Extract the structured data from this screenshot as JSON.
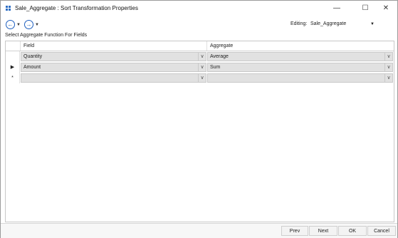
{
  "window": {
    "title": "Sale_Aggregate : Sort Transformation Properties",
    "minimize": "—",
    "maximize": "☐",
    "close": "✕"
  },
  "toolbar": {
    "back_icon": "←",
    "forward_icon": "→",
    "dropdown_glyph": "▼",
    "editing_label": "Editing:",
    "editing_value": "Sale_Aggregate",
    "editing_arrow": "▼"
  },
  "section": {
    "label": "Select Aggregate Function For Fields"
  },
  "grid": {
    "columns": [
      "Field",
      "Aggregate"
    ],
    "rows": [
      {
        "marker": "",
        "field": "Quantity",
        "aggregate": "Average"
      },
      {
        "marker": "▶",
        "field": "Amount",
        "aggregate": "Sum"
      },
      {
        "marker": "*",
        "field": "",
        "aggregate": ""
      }
    ],
    "dropdown_glyph": "∨"
  },
  "footer": {
    "prev": "Prev",
    "next": "Next",
    "ok": "OK",
    "cancel": "Cancel"
  }
}
